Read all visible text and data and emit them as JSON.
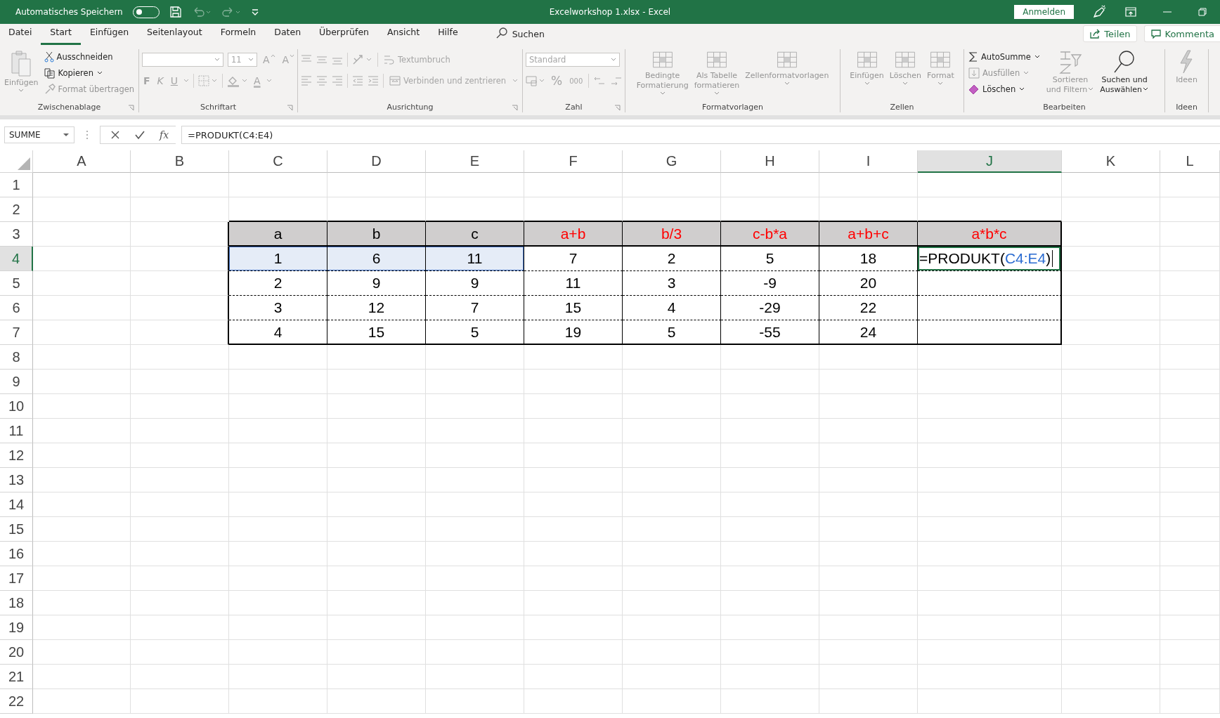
{
  "title_bar": {
    "autosave_label": "Automatisches Speichern",
    "autosave_on": false,
    "title": "Excelworkshop 1.xlsx  -  Excel",
    "sign_in_button": "Anmelden"
  },
  "menu_tabs": [
    {
      "label": "Datei",
      "selected": false
    },
    {
      "label": "Start",
      "selected": true
    },
    {
      "label": "Einfügen",
      "selected": false
    },
    {
      "label": "Seitenlayout",
      "selected": false
    },
    {
      "label": "Formeln",
      "selected": false
    },
    {
      "label": "Daten",
      "selected": false
    },
    {
      "label": "Überprüfen",
      "selected": false
    },
    {
      "label": "Ansicht",
      "selected": false
    },
    {
      "label": "Hilfe",
      "selected": false
    }
  ],
  "search": {
    "label": "Suchen"
  },
  "share_button": "Teilen",
  "comments_button": "Kommenta",
  "ribbon": {
    "clipboard": {
      "label": "Zwischenablage",
      "paste": {
        "label": "Einfügen",
        "disabled": true
      },
      "cut": {
        "label": "Ausschneiden",
        "disabled": false
      },
      "copy": {
        "label": "Kopieren",
        "disabled": false
      },
      "format_painter": {
        "label": "Format übertragen",
        "disabled": true
      }
    },
    "font": {
      "label": "Schriftart",
      "disabled": true,
      "font_size": "11",
      "grow": "A",
      "shrink": "A",
      "bold": "F",
      "italic": "K",
      "underline": "U",
      "font_color": "A"
    },
    "alignment": {
      "label": "Ausrichtung",
      "disabled": true,
      "wrap_text": "Textumbruch",
      "merge": "Verbinden und zentrieren"
    },
    "number": {
      "label": "Zahl",
      "disabled": true,
      "format": "Standard",
      "percent": "%",
      "thousands": "000"
    },
    "styles": {
      "label": "Formatvorlagen",
      "items": [
        {
          "lines": [
            "Bedingte",
            "Formatierung"
          ],
          "disabled": true
        },
        {
          "lines": [
            "Als Tabelle",
            "formatieren"
          ],
          "disabled": true
        },
        {
          "lines": [
            "Zellenformatvorlagen"
          ],
          "disabled": true
        }
      ]
    },
    "cells": {
      "label": "Zellen",
      "items": [
        {
          "lines": [
            "Einfügen"
          ],
          "disabled": true
        },
        {
          "lines": [
            "Löschen"
          ],
          "disabled": true
        },
        {
          "lines": [
            "Format"
          ],
          "disabled": true
        }
      ]
    },
    "editing": {
      "label": "Bearbeiten",
      "small_items": [
        {
          "label": "AutoSumme",
          "disabled": false
        },
        {
          "label": "Ausfüllen",
          "disabled": true
        },
        {
          "label": "Löschen",
          "disabled": false
        }
      ],
      "items": [
        {
          "lines": [
            "Sortieren",
            "und Filtern"
          ],
          "disabled": true
        },
        {
          "lines": [
            "Suchen und",
            "Auswählen"
          ],
          "disabled": false
        }
      ]
    },
    "ideas": {
      "label": "Ideen",
      "items": [
        {
          "lines": [
            "Ideen"
          ],
          "disabled": true
        }
      ]
    }
  },
  "formula_bar": {
    "name_box": "SUMME",
    "insert_function": "fx",
    "formula": "=PRODUKT(C4:E4)"
  },
  "sheet": {
    "columns": [
      {
        "label": "A",
        "selected": false
      },
      {
        "label": "B",
        "selected": false
      },
      {
        "label": "C",
        "selected": false
      },
      {
        "label": "D",
        "selected": false
      },
      {
        "label": "E",
        "selected": false
      },
      {
        "label": "F",
        "selected": false
      },
      {
        "label": "G",
        "selected": false
      },
      {
        "label": "H",
        "selected": false
      },
      {
        "label": "I",
        "selected": false
      },
      {
        "label": "J",
        "selected": true
      },
      {
        "label": "K",
        "selected": false
      },
      {
        "label": "L",
        "selected": false
      }
    ],
    "rows": [
      {
        "label": "1",
        "selected": false
      },
      {
        "label": "2",
        "selected": false
      },
      {
        "label": "3",
        "selected": false
      },
      {
        "label": "4",
        "selected": true
      },
      {
        "label": "5",
        "selected": false
      },
      {
        "label": "6",
        "selected": false
      },
      {
        "label": "7",
        "selected": false
      },
      {
        "label": "8",
        "selected": false
      },
      {
        "label": "9",
        "selected": false
      },
      {
        "label": "10",
        "selected": false
      },
      {
        "label": "11",
        "selected": false
      },
      {
        "label": "12",
        "selected": false
      },
      {
        "label": "13",
        "selected": false
      },
      {
        "label": "14",
        "selected": false
      },
      {
        "label": "15",
        "selected": false
      },
      {
        "label": "16",
        "selected": false
      },
      {
        "label": "17",
        "selected": false
      },
      {
        "label": "18",
        "selected": false
      },
      {
        "label": "19",
        "selected": false
      },
      {
        "label": "20",
        "selected": false
      },
      {
        "label": "21",
        "selected": false
      },
      {
        "label": "22",
        "selected": false
      }
    ],
    "table": {
      "header": [
        {
          "text": "a",
          "color": "#000000"
        },
        {
          "text": "b",
          "color": "#000000"
        },
        {
          "text": "c",
          "color": "#000000"
        },
        {
          "text": "a+b",
          "color": "#ff0000"
        },
        {
          "text": "b/3",
          "color": "#ff0000"
        },
        {
          "text": "c-b*a",
          "color": "#ff0000"
        },
        {
          "text": "a+b+c",
          "color": "#ff0000"
        },
        {
          "text": "a*b*c",
          "color": "#ff0000"
        }
      ],
      "rows": [
        {
          "cells": [
            {
              "kind": "value",
              "text": "1",
              "selected": true
            },
            {
              "kind": "value",
              "text": "6",
              "selected": true
            },
            {
              "kind": "value",
              "text": "11",
              "selected": true
            },
            {
              "kind": "value",
              "text": "7",
              "selected": false
            },
            {
              "kind": "value",
              "text": "2",
              "selected": false
            },
            {
              "kind": "value",
              "text": "5",
              "selected": false
            },
            {
              "kind": "value",
              "text": "18",
              "selected": false
            },
            {
              "kind": "formula",
              "prefix": "=PRODUKT(",
              "reference": "C4:E4",
              "suffix": ")"
            }
          ]
        },
        {
          "cells": [
            {
              "kind": "value",
              "text": "2",
              "selected": false
            },
            {
              "kind": "value",
              "text": "9",
              "selected": false
            },
            {
              "kind": "value",
              "text": "9",
              "selected": false
            },
            {
              "kind": "value",
              "text": "11",
              "selected": false
            },
            {
              "kind": "value",
              "text": "3",
              "selected": false
            },
            {
              "kind": "value",
              "text": "-9",
              "selected": false
            },
            {
              "kind": "value",
              "text": "20",
              "selected": false
            }
          ]
        },
        {
          "cells": [
            {
              "kind": "value",
              "text": "3",
              "selected": false
            },
            {
              "kind": "value",
              "text": "12",
              "selected": false
            },
            {
              "kind": "value",
              "text": "7",
              "selected": false
            },
            {
              "kind": "value",
              "text": "15",
              "selected": false
            },
            {
              "kind": "value",
              "text": "4",
              "selected": false
            },
            {
              "kind": "value",
              "text": "-29",
              "selected": false
            },
            {
              "kind": "value",
              "text": "22",
              "selected": false
            }
          ]
        },
        {
          "cells": [
            {
              "kind": "value",
              "text": "4",
              "selected": false
            },
            {
              "kind": "value",
              "text": "15",
              "selected": false
            },
            {
              "kind": "value",
              "text": "5",
              "selected": false
            },
            {
              "kind": "value",
              "text": "19",
              "selected": false
            },
            {
              "kind": "value",
              "text": "5",
              "selected": false
            },
            {
              "kind": "value",
              "text": "-55",
              "selected": false
            },
            {
              "kind": "value",
              "text": "24",
              "selected": false
            }
          ]
        }
      ]
    }
  }
}
